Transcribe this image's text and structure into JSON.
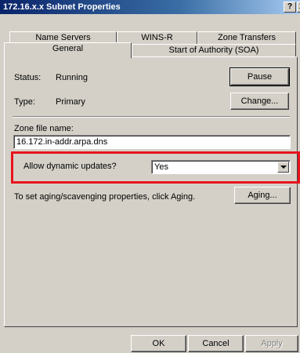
{
  "window": {
    "title": "172.16.x.x Subnet Properties",
    "help_button": "?",
    "close_partial": "X"
  },
  "tabs": {
    "row1": [
      "Name Servers",
      "WINS-R",
      "Zone Transfers"
    ],
    "row2": [
      "General",
      "Start of Authority (SOA)"
    ],
    "active": "General"
  },
  "general": {
    "status_label": "Status:",
    "status_value": "Running",
    "pause_button": "Pause",
    "type_label": "Type:",
    "type_value": "Primary",
    "change_button": "Change...",
    "zone_file_label": "Zone file name:",
    "zone_file_value": "16.172.in-addr.arpa.dns",
    "dynamic_updates_label": "Allow dynamic updates?",
    "dynamic_updates_value": "Yes",
    "aging_text": "To set aging/scavenging properties, click Aging.",
    "aging_button": "Aging..."
  },
  "footer": {
    "ok_button": "OK",
    "cancel_button": "Cancel",
    "apply_button": "Apply"
  },
  "colors": {
    "highlight_box": "#e8141c",
    "dialog_face": "#d4d0c8",
    "title_start": "#0a246a"
  }
}
